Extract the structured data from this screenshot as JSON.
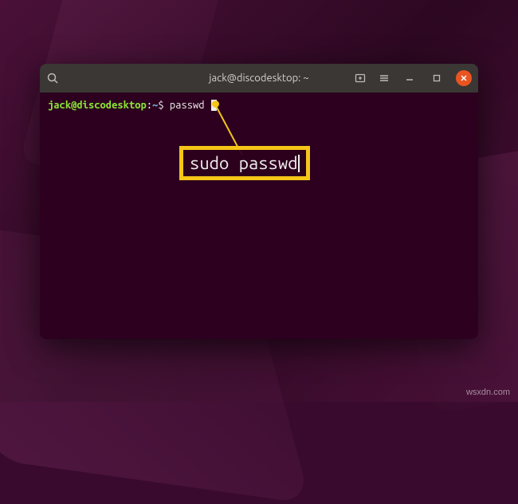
{
  "terminal": {
    "title": "jack@discodesktop: ~",
    "prompt": {
      "user_host": "jack@discodesktop",
      "separator": ":",
      "path": "~",
      "symbol": "$",
      "command": "passwd"
    }
  },
  "annotation": {
    "text": "sudo passwd"
  },
  "watermark": "wsxdn.com"
}
